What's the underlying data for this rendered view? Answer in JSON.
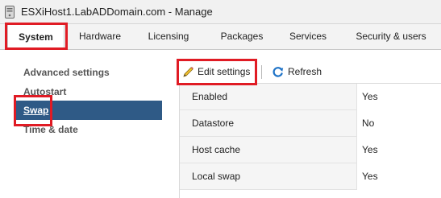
{
  "window": {
    "title": "ESXiHost1.LabADDomain.com - Manage",
    "icon": "server-icon"
  },
  "tabs": [
    {
      "label": "System",
      "active": true
    },
    {
      "label": "Hardware",
      "active": false
    },
    {
      "label": "Licensing",
      "active": false
    },
    {
      "label": "Packages",
      "active": false
    },
    {
      "label": "Services",
      "active": false
    },
    {
      "label": "Security & users",
      "active": false
    }
  ],
  "sidebar": {
    "items": [
      {
        "label": "Advanced settings",
        "selected": false
      },
      {
        "label": "Autostart",
        "selected": false
      },
      {
        "label": "Swap",
        "selected": true
      },
      {
        "label": "Time & date",
        "selected": false
      }
    ]
  },
  "toolbar": {
    "edit_label": "Edit settings",
    "edit_icon": "pencil-icon",
    "refresh_label": "Refresh",
    "refresh_icon": "refresh-icon"
  },
  "settings": {
    "rows": [
      {
        "key": "Enabled",
        "value": "Yes"
      },
      {
        "key": "Datastore",
        "value": "No"
      },
      {
        "key": "Host cache",
        "value": "Yes"
      },
      {
        "key": "Local swap",
        "value": "Yes"
      }
    ]
  },
  "colors": {
    "highlight": "#e01b24",
    "selected_bg": "#2f5a86",
    "refresh_blue": "#1f73c7"
  }
}
